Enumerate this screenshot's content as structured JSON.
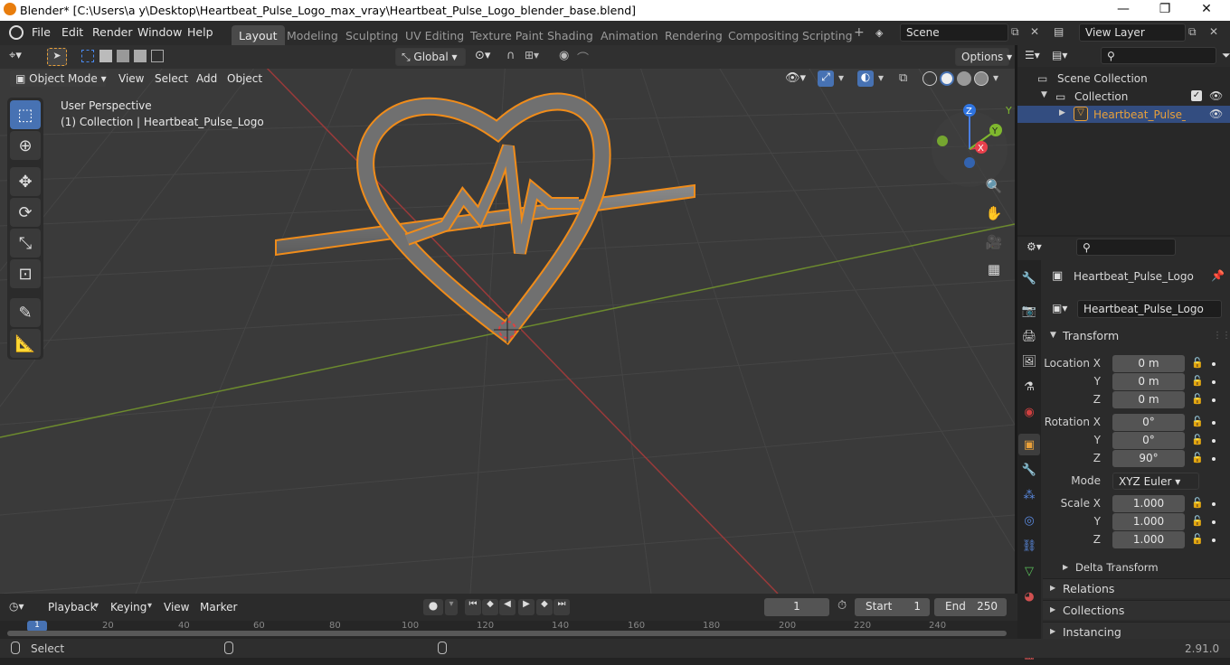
{
  "window": {
    "title": "Blender* [C:\\Users\\a y\\Desktop\\Heartbeat_Pulse_Logo_max_vray\\Heartbeat_Pulse_Logo_blender_base.blend]",
    "min": "—",
    "max": "❐",
    "close": "✕"
  },
  "menu": [
    "File",
    "Edit",
    "Render",
    "Window",
    "Help"
  ],
  "workspaces": [
    "Layout",
    "Modeling",
    "Sculpting",
    "UV Editing",
    "Texture Paint",
    "Shading",
    "Animation",
    "Rendering",
    "Compositing",
    "Scripting"
  ],
  "scene": {
    "label": "Scene",
    "add": "+"
  },
  "view_layer": {
    "label": "View Layer"
  },
  "viewport": {
    "mode": "Object Mode",
    "menus": [
      "View",
      "Select",
      "Add",
      "Object"
    ],
    "orientation": "Global",
    "options": "Options",
    "info_line1": "User Perspective",
    "info_line2": "(1) Collection | Heartbeat_Pulse_Logo",
    "gizmo": {
      "x": "X",
      "y": "Y",
      "z": "Z"
    }
  },
  "outliner": {
    "scene_collection": "Scene Collection",
    "collection": "Collection",
    "object": "Heartbeat_Pulse_Logo"
  },
  "properties": {
    "object_name": "Heartbeat_Pulse_Logo",
    "data_name": "Heartbeat_Pulse_Logo",
    "transform": "Transform",
    "location_x_label": "Location X",
    "y_label": "Y",
    "z_label": "Z",
    "location": [
      "0 m",
      "0 m",
      "0 m"
    ],
    "rotation_x_label": "Rotation X",
    "rotation": [
      "0°",
      "0°",
      "90°"
    ],
    "mode_label": "Mode",
    "mode_value": "XYZ Euler",
    "scale_x_label": "Scale X",
    "scale": [
      "1.000",
      "1.000",
      "1.000"
    ],
    "delta": "Delta Transform",
    "relations": "Relations",
    "collections": "Collections",
    "instancing": "Instancing"
  },
  "timeline": {
    "menus": [
      "Playback",
      "Keying",
      "View",
      "Marker"
    ],
    "current_frame": "1",
    "start_label": "Start",
    "start": "1",
    "end_label": "End",
    "end": "250",
    "ruler": [
      "20",
      "40",
      "60",
      "80",
      "100",
      "120",
      "140",
      "160",
      "180",
      "200",
      "220",
      "240"
    ],
    "playhead": "1"
  },
  "status": {
    "select": "Select",
    "version": "2.91.0"
  }
}
